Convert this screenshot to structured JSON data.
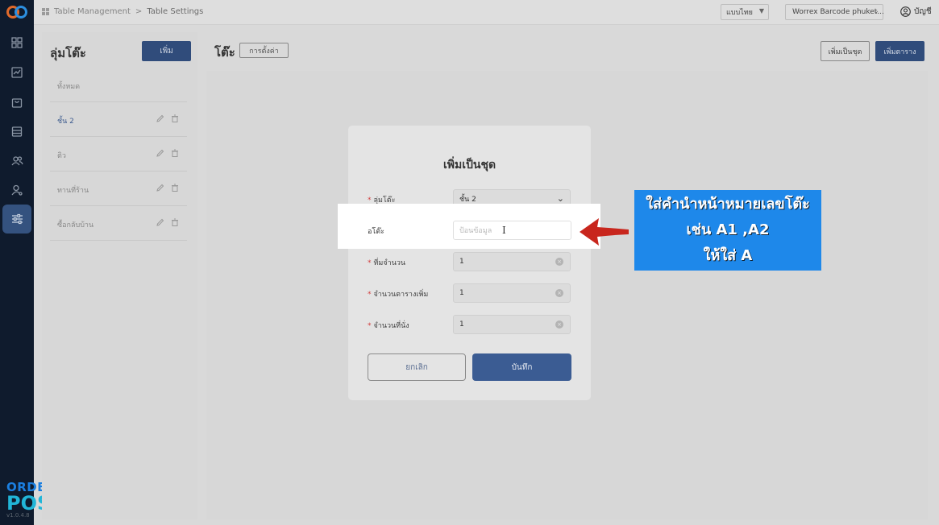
{
  "colors": {
    "sidebar": "#0f1b2d",
    "primary": "#304c7b",
    "annotation": "#1e88ea",
    "arrow": "#c8261d"
  },
  "breadcrumb": {
    "section": "Table Management",
    "current": "Table Settings"
  },
  "header": {
    "language": "แบบไทย",
    "branch": "Worrex Barcode phuket...",
    "account": "บัญชี"
  },
  "sidebar": {
    "icons": [
      "dashboard-icon",
      "chart-icon",
      "shopping-bag-icon",
      "stack-icon",
      "users-icon",
      "user-settings-icon",
      "sliders-icon"
    ],
    "brand_top": "ORDER",
    "brand_bottom": "POS",
    "version": "v1.0.4.8"
  },
  "groups": {
    "title": "ลุ่มโต๊ะ",
    "add_button": "เพิ่ม",
    "items": [
      {
        "label": "ทั้งหมด",
        "selected": false,
        "editable": false
      },
      {
        "label": "ชั้น 2",
        "selected": true,
        "editable": true
      },
      {
        "label": "ติว",
        "selected": false,
        "editable": true
      },
      {
        "label": "ทานที่ร้าน",
        "selected": false,
        "editable": true
      },
      {
        "label": "ซื้อกลับบ้าน",
        "selected": false,
        "editable": true
      }
    ]
  },
  "main": {
    "title": "โต๊ะ",
    "settings_button": "การตั้งค่า",
    "add_set_button": "เพิ่มเป็นชุด",
    "add_table_button": "เพิ่มตาราง"
  },
  "modal": {
    "title": "เพิ่มเป็นชุด",
    "fields": {
      "group": {
        "label": "ลุ่มโต๊ะ",
        "value": "ชั้น 2"
      },
      "prefix": {
        "label": "อโต๊ะ",
        "placeholder": "ป้อนข้อมูล"
      },
      "count": {
        "label": "ที่มจำนวน",
        "value": "1"
      },
      "tables": {
        "label": "จำนวนตารางเพิ่ม",
        "value": "1"
      },
      "seats": {
        "label": "จำนวนที่นั่ง",
        "value": "1"
      }
    },
    "cancel": "ยกเลิก",
    "save": "บันทึก"
  },
  "annotation": {
    "lines": [
      "ใส่คำนำหน้าหมายเลขโต๊ะ",
      "เช่น A1 ,A2",
      "ให้ใส่ A"
    ]
  }
}
